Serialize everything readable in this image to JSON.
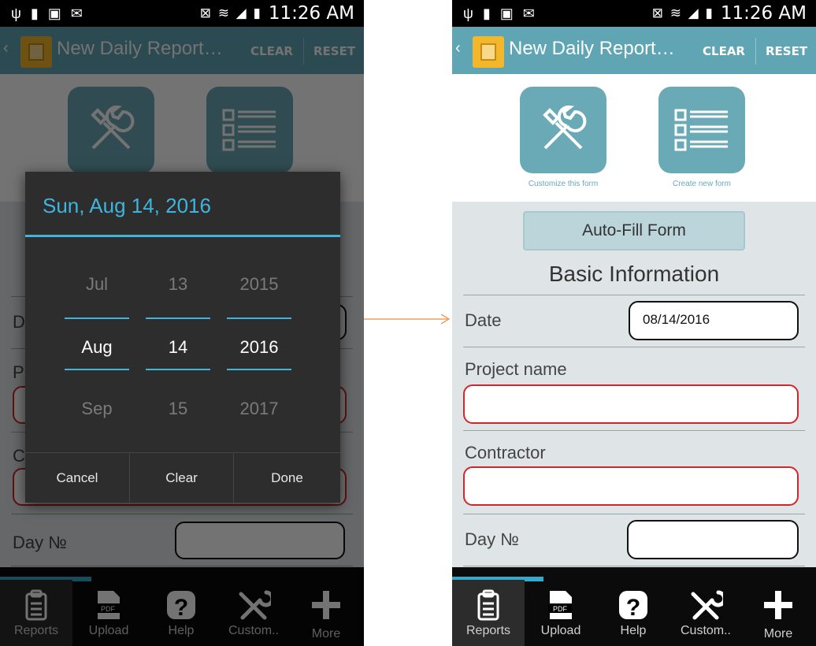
{
  "status_bar": {
    "time": "11:26 AM",
    "battery_label": "100"
  },
  "app_bar": {
    "back_glyph": "‹",
    "title": "New Daily Report…",
    "clear_label": "CLEAR",
    "reset_label": "RESET"
  },
  "shortcuts": {
    "customize_caption": "Customize this form",
    "create_caption": "Create new form"
  },
  "form": {
    "autofill_label": "Auto-Fill Form",
    "section_title": "Basic Information",
    "date_label": "Date",
    "date_value": "08/14/2016",
    "project_label": "Project name",
    "project_value": "",
    "contractor_label": "Contractor",
    "contractor_value": "",
    "day_label": "Day №",
    "day_value": ""
  },
  "date_picker": {
    "header": "Sun, Aug 14, 2016",
    "month": {
      "prev": "Jul",
      "current": "Aug",
      "next": "Sep"
    },
    "day": {
      "prev": "13",
      "current": "14",
      "next": "15"
    },
    "year": {
      "prev": "2015",
      "current": "2016",
      "next": "2017"
    },
    "cancel_label": "Cancel",
    "clear_label": "Clear",
    "done_label": "Done"
  },
  "tabs": [
    {
      "label": "Reports",
      "icon": "clipboard-icon",
      "selected": true
    },
    {
      "label": "Upload",
      "icon": "pdf-icon",
      "selected": false
    },
    {
      "label": "Help",
      "icon": "help-icon",
      "selected": false
    },
    {
      "label": "Custom..",
      "icon": "tools-icon",
      "selected": false
    },
    {
      "label": "More",
      "icon": "plus-icon",
      "selected": false
    }
  ],
  "colors": {
    "app_bar": "#5fa5b4",
    "accent": "#3fb5dd",
    "required_border": "#d3252a",
    "tile": "#6aa9b6",
    "arrow": "#f08a3c"
  }
}
